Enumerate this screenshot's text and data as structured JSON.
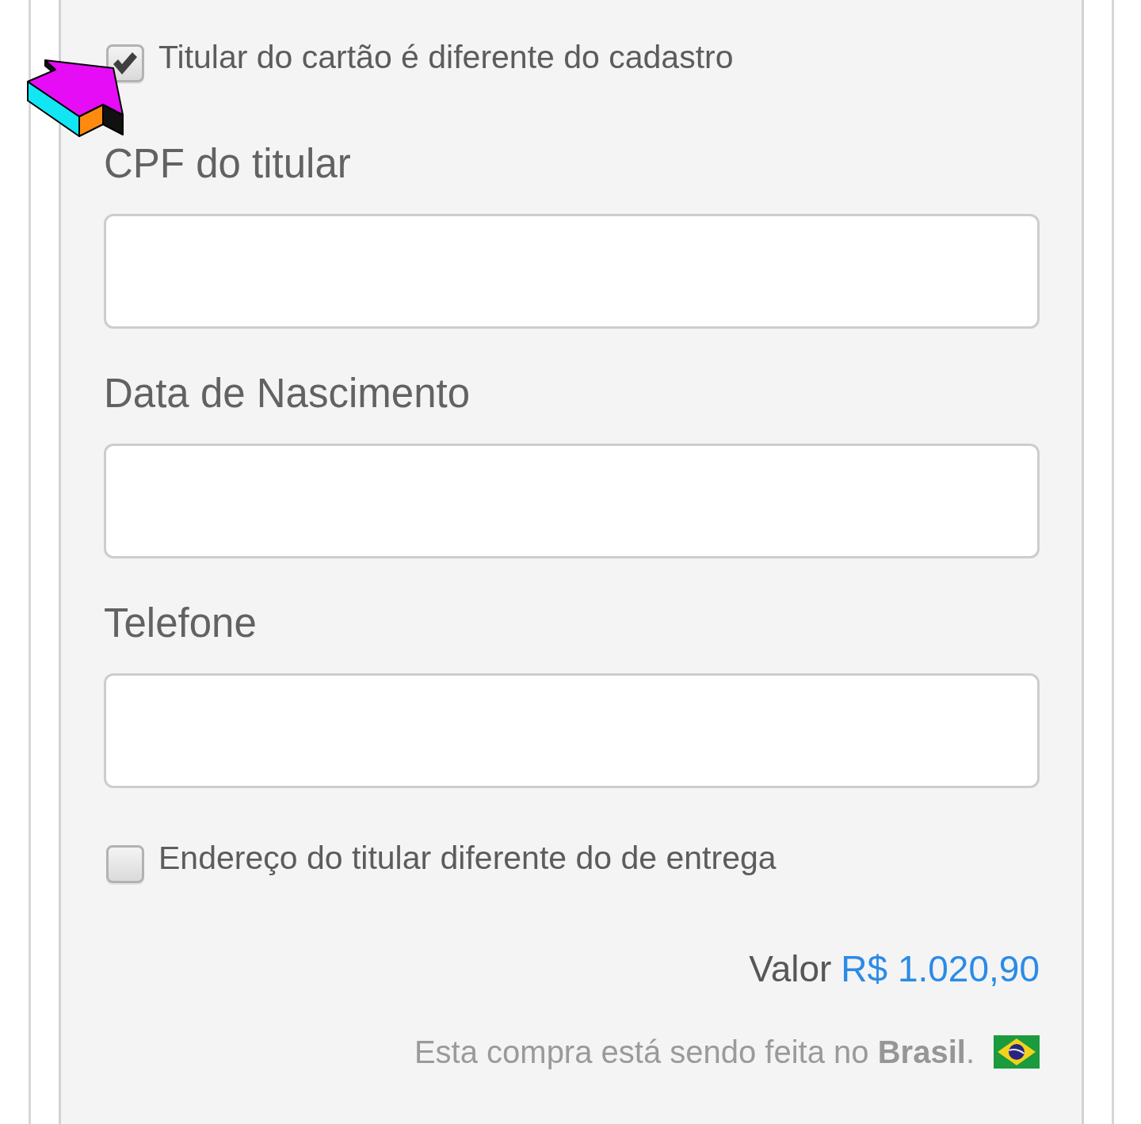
{
  "holder_toggle": {
    "label": "Titular do cartão é diferente do cadastro",
    "checked": true
  },
  "fields": [
    {
      "label": "CPF do titular"
    },
    {
      "label": "Data de Nascimento"
    },
    {
      "label": "Telefone"
    }
  ],
  "address_toggle": {
    "label": "Endereço do titular diferente do de entrega",
    "checked": false
  },
  "total": {
    "label": "Valor",
    "amount": "R$ 1.020,90"
  },
  "country_note": "Esta compra está sendo feita no **Brasil**."
}
